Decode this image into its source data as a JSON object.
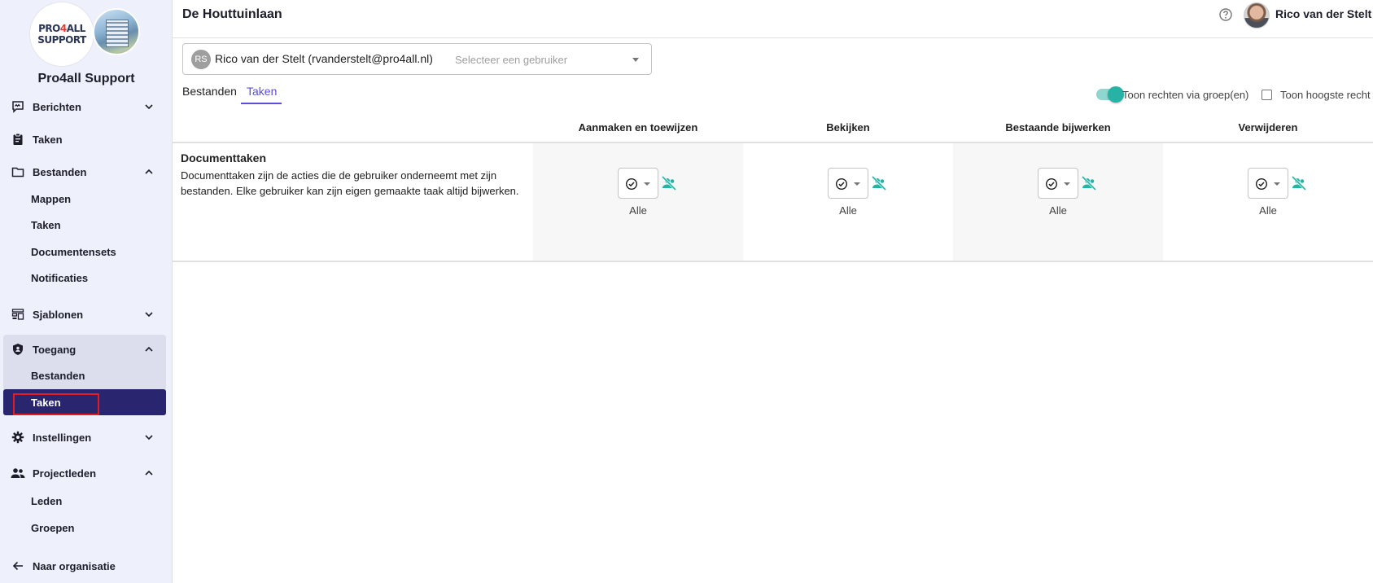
{
  "sidebar": {
    "logo": {
      "line1_a": "PRO",
      "line1_b": "4",
      "line1_c": "ALL",
      "line2": "SUPPORT"
    },
    "org_name": "Pro4all Support",
    "items": [
      {
        "label": "Berichten",
        "icon": "messages-icon",
        "expanded": false
      },
      {
        "label": "Taken",
        "icon": "clipboard-icon"
      },
      {
        "label": "Bestanden",
        "icon": "folder-icon",
        "expanded": true,
        "children": [
          "Mappen",
          "Taken",
          "Documentensets",
          "Notificaties"
        ]
      },
      {
        "label": "Sjablonen",
        "icon": "templates-icon",
        "expanded": false
      },
      {
        "label": "Toegang",
        "icon": "shield-icon",
        "expanded": true,
        "children": [
          "Bestanden",
          "Taken"
        ],
        "active_child": "Taken"
      },
      {
        "label": "Instellingen",
        "icon": "gear-icon",
        "expanded": false
      },
      {
        "label": "Projectleden",
        "icon": "people-icon",
        "expanded": true,
        "children": [
          "Leden",
          "Groepen"
        ]
      }
    ],
    "back_link": "Naar organisatie"
  },
  "header": {
    "title": "De Houttuinlaan",
    "user_name": "Rico van der Stelt"
  },
  "user_select": {
    "chip_initials": "RS",
    "chip_label": "Rico van der Stelt (rvanderstelt@pro4all.nl)",
    "placeholder": "Selecteer een gebruiker"
  },
  "tabs": [
    {
      "label": "Bestanden",
      "active": false
    },
    {
      "label": "Taken",
      "active": true
    }
  ],
  "options": {
    "toggle_label": "Toon rechten via groep(en)",
    "toggle_on": true,
    "checkbox_label": "Toon hoogste recht",
    "checkbox_checked": false
  },
  "table": {
    "columns": [
      "Aanmaken en toewijzen",
      "Bekijken",
      "Bestaande bijwerken",
      "Verwijderen"
    ],
    "rows": [
      {
        "title": "Documenttaken",
        "description": "Documenttaken zijn de acties die de gebruiker onderneemt met zijn bestanden. Elke gebruiker kan zijn eigen gemaakte taak altijd bijwerken.",
        "cells": [
          "Alle",
          "Alle",
          "Alle",
          "Alle"
        ]
      }
    ]
  },
  "colors": {
    "accent": "#5b4fd8",
    "active_nav": "#2a256f",
    "teal": "#26b3a6",
    "sidebar_bg": "#eef0fb"
  }
}
